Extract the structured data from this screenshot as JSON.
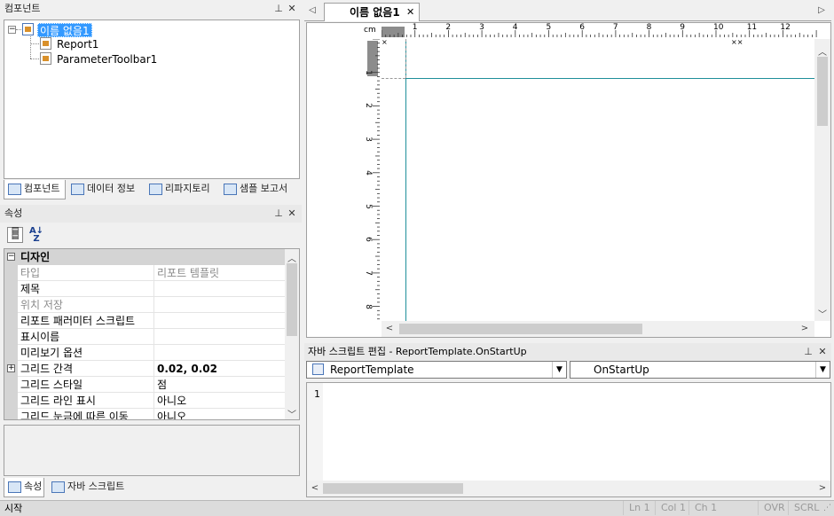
{
  "component_panel": {
    "title": "컴포넌트",
    "tree": {
      "root": "이름 없음1",
      "children": [
        "Report1",
        "ParameterToolbar1"
      ]
    },
    "tabs": [
      {
        "label": "컴포넌트"
      },
      {
        "label": "데이터 정보"
      },
      {
        "label": "리파지토리"
      },
      {
        "label": "샘플 보고서"
      }
    ]
  },
  "properties_panel": {
    "title": "속성",
    "category": "디자인",
    "rows": [
      {
        "name": "타입",
        "value": "리포트 템플릿"
      },
      {
        "name": "제목",
        "value": ""
      },
      {
        "name": "위치 저장",
        "value": ""
      },
      {
        "name": "리포트 패러미터 스크립트",
        "value": ""
      },
      {
        "name": "표시이름",
        "value": ""
      },
      {
        "name": "미리보기 옵션",
        "value": ""
      },
      {
        "name": "그리드 간격",
        "value": "0.02, 0.02"
      },
      {
        "name": "그리드 스타일",
        "value": "점"
      },
      {
        "name": "그리드 라인 표시",
        "value": "아니오"
      },
      {
        "name": "그리드 눈금에 따른 이동",
        "value": "아니오"
      }
    ],
    "tabs": [
      {
        "label": "속성"
      },
      {
        "label": "자바 스크립트"
      }
    ]
  },
  "designer": {
    "document_tab": "이름 없음1",
    "ruler_unit": "cm",
    "h_ticks": [
      "1",
      "2",
      "3",
      "4",
      "5",
      "6",
      "7",
      "8",
      "9",
      "10",
      "11",
      "12"
    ],
    "v_ticks": [
      "1",
      "2",
      "3",
      "4",
      "5",
      "6",
      "7",
      "8"
    ]
  },
  "script_editor": {
    "title": "자바 스크립트 편집 - ReportTemplate.OnStartUp",
    "object_combo": "ReportTemplate",
    "event_combo": "OnStartUp",
    "line_numbers": [
      "1"
    ]
  },
  "status_bar": {
    "left": "시작",
    "ln": "Ln 1",
    "col": "Col 1",
    "ch": "Ch 1",
    "ovr": "OVR",
    "scrl": "SCRL"
  },
  "colors": {
    "selection": "#3399ff",
    "margin_line": "#1f8f9a",
    "panel_bg": "#f0f0f0"
  }
}
